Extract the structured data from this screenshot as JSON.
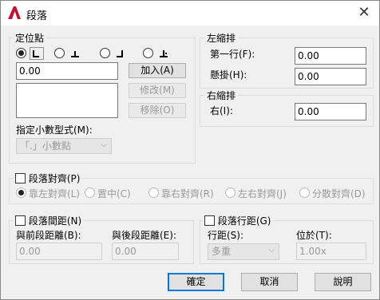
{
  "window": {
    "title": "段落",
    "close": "✕"
  },
  "tab_stops": {
    "label": "定位點",
    "value": "0.00",
    "buttons": {
      "add": "加入(A)",
      "modify": "修改(M)",
      "remove": "移除(O)"
    },
    "decimal_label": "指定小數型式(M):",
    "decimal_value": "「.」小數點"
  },
  "left_indent": {
    "label": "左縮排",
    "first_line_label": "第一行(F):",
    "first_line_value": "0.00",
    "hanging_label": "懸掛(H):",
    "hanging_value": "0.00"
  },
  "right_indent": {
    "label": "右縮排",
    "right_label": "右(I):",
    "right_value": "0.00"
  },
  "alignment": {
    "label": "段落對齊(P)",
    "options": [
      "靠左對齊(L)",
      "置中(C)",
      "靠右對齊(R)",
      "左右對齊(J)",
      "分散對齊(D)"
    ]
  },
  "spacing": {
    "label": "段落間距(N)",
    "before_label": "與前段距離(B):",
    "before_value": "0.00",
    "after_label": "與後段距離(E):",
    "after_value": "0.00"
  },
  "line_spacing": {
    "label": "段落行距(G)",
    "spacing_label": "行距(S):",
    "spacing_value": "多重",
    "at_label": "位於(T):",
    "at_value": "1.00x"
  },
  "footer": {
    "ok": "確定",
    "cancel": "取消",
    "help": "說明"
  },
  "colors": {
    "app_icon": "#c8102e",
    "accent": "#0078d7"
  }
}
